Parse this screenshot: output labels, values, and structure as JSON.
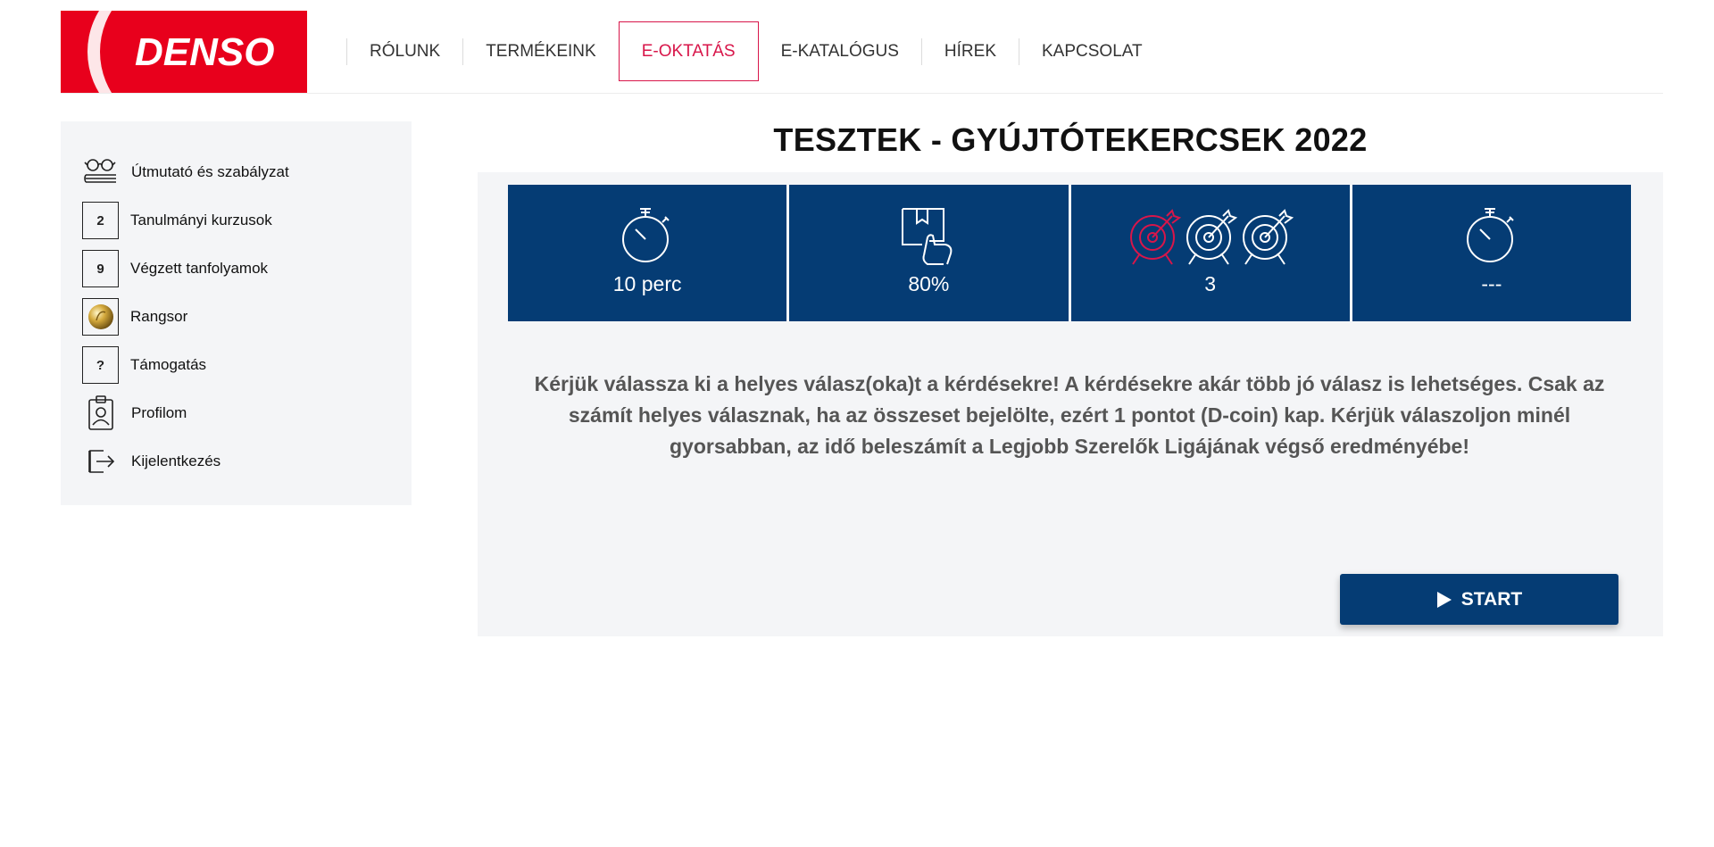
{
  "logo": {
    "text": "DENSO",
    "colors": {
      "red": "#e8001c",
      "white": "#ffffff"
    }
  },
  "nav": {
    "items": [
      {
        "label": "RÓLUNK"
      },
      {
        "label": "TERMÉKEINK"
      },
      {
        "label": "E-OKTATÁS",
        "active": true
      },
      {
        "label": "E-KATALÓGUS"
      },
      {
        "label": "HÍREK"
      },
      {
        "label": "KAPCSOLAT"
      }
    ],
    "active_color": "#d8164a"
  },
  "sidebar": {
    "items": [
      {
        "icon": "glasses-book-icon",
        "label": "Útmutató és szabályzat"
      },
      {
        "icon": "count-badge",
        "badge": "2",
        "label": "Tanulmányi kurzusok"
      },
      {
        "icon": "count-badge",
        "badge": "9",
        "label": "Végzett tanfolyamok"
      },
      {
        "icon": "gold-coin-icon",
        "label": "Rangsor"
      },
      {
        "icon": "question-badge",
        "badge": "?",
        "label": "Támogatás"
      },
      {
        "icon": "id-badge-icon",
        "label": "Profilom"
      },
      {
        "icon": "logout-icon",
        "label": "Kijelentkezés"
      }
    ]
  },
  "main": {
    "title": "TESZTEK - GYÚJTÓTEKERCSEK 2022",
    "stats": [
      {
        "icon": "stopwatch-icon",
        "value": "10 perc"
      },
      {
        "icon": "box-hand-icon",
        "value": "80%"
      },
      {
        "icon": "target-attempts-icon",
        "value": "3",
        "attempts_used": 1,
        "attempts_total": 3
      },
      {
        "icon": "stopwatch-icon",
        "value": "---"
      }
    ],
    "instructions": "Kérjük válassza ki a helyes válasz(oka)t a kérdésekre! A kérdésekre akár több jó válasz is lehetséges. Csak az számít helyes válasznak, ha az összeset bejelölte, ezért 1 pontot (D-coin) kap. Kérjük válaszoljon minél gyorsabban, az idő beleszámít a Legjobb Szerelők Ligájának végső eredményébe!",
    "start_button": "START",
    "colors": {
      "stat_bg": "#053c74",
      "target_used": "#d8164a"
    }
  }
}
